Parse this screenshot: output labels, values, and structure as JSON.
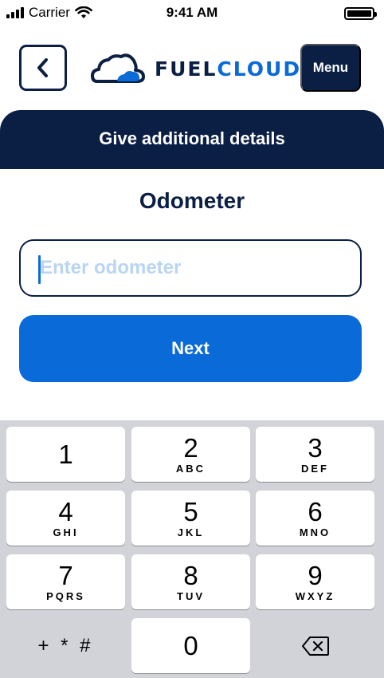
{
  "status_bar": {
    "carrier": "Carrier",
    "time": "9:41 AM"
  },
  "header": {
    "back_icon": "chevron-left-icon",
    "logo_fuel": "FUEL",
    "logo_cloud": "CLOUD",
    "menu_label": "Menu"
  },
  "banner": {
    "text": "Give additional details"
  },
  "field": {
    "title": "Odometer",
    "placeholder": "Enter odometer",
    "value": ""
  },
  "next_button": {
    "label": "Next"
  },
  "keypad": {
    "keys": [
      {
        "digit": "1",
        "letters": ""
      },
      {
        "digit": "2",
        "letters": "ABC"
      },
      {
        "digit": "3",
        "letters": "DEF"
      },
      {
        "digit": "4",
        "letters": "GHI"
      },
      {
        "digit": "5",
        "letters": "JKL"
      },
      {
        "digit": "6",
        "letters": "MNO"
      },
      {
        "digit": "7",
        "letters": "PQRS"
      },
      {
        "digit": "8",
        "letters": "TUV"
      },
      {
        "digit": "9",
        "letters": "WXYZ"
      },
      {
        "digit": "0",
        "letters": ""
      }
    ],
    "symbols_label": "+ * #",
    "delete_icon": "backspace-icon"
  },
  "colors": {
    "navy": "#0b1f45",
    "brand_blue": "#0a6ad8",
    "placeholder": "#b9d5f3",
    "keypad_bg": "#d1d3d9"
  }
}
